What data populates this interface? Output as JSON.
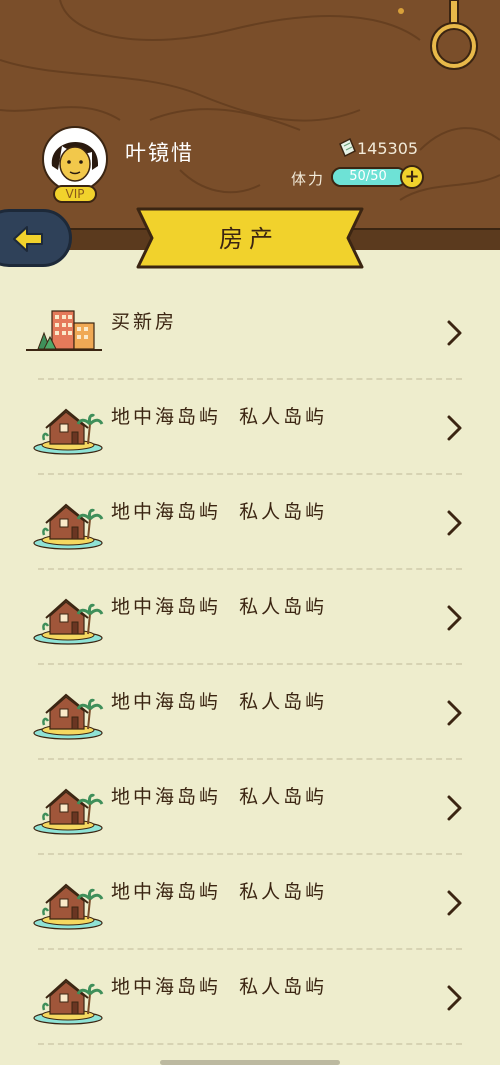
{
  "player": {
    "name": "叶镜惜",
    "vip_label": "VIP",
    "money": "145305",
    "stamina_label": "体力",
    "stamina_value": "50/50",
    "stamina_fraction": 1.0
  },
  "page": {
    "title": "房产"
  },
  "list": {
    "items": [
      {
        "label": "买新房",
        "icon": "city-buildings-icon"
      },
      {
        "label": "地中海岛屿  私人岛屿",
        "icon": "island-house-icon"
      },
      {
        "label": "地中海岛屿  私人岛屿",
        "icon": "island-house-icon"
      },
      {
        "label": "地中海岛屿  私人岛屿",
        "icon": "island-house-icon"
      },
      {
        "label": "地中海岛屿  私人岛屿",
        "icon": "island-house-icon"
      },
      {
        "label": "地中海岛屿  私人岛屿",
        "icon": "island-house-icon"
      },
      {
        "label": "地中海岛屿  私人岛屿",
        "icon": "island-house-icon"
      },
      {
        "label": "地中海岛屿  私人岛屿",
        "icon": "island-house-icon"
      }
    ]
  },
  "colors": {
    "wood": "#7a4e2a",
    "banner": "#f1d22c",
    "background": "#eeedcd",
    "stamina": "#53d3c9",
    "text": "#3b2512"
  }
}
